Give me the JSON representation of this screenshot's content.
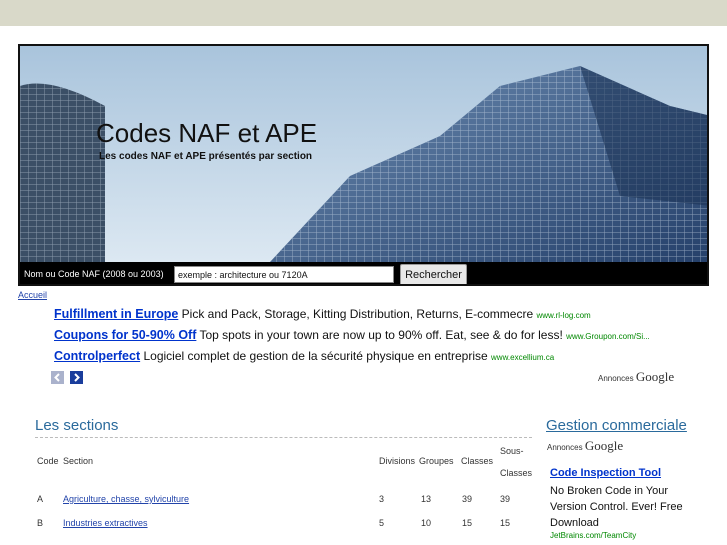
{
  "header": {
    "site_title": "Codes NAF et APE",
    "site_subtitle": "Les codes NAF et APE présentés par section"
  },
  "search": {
    "label": "Nom ou Code NAF (2008 ou 2003)",
    "value": "exemple : architecture ou 7120A",
    "button": "Rechercher"
  },
  "breadcrumb": "Accueil",
  "ads": [
    {
      "title": "Fulfillment in Europe",
      "text": "Pick and Pack, Storage, Kitting Distribution, Returns, E-commecre",
      "url": "www.rl-log.com"
    },
    {
      "title": "Coupons for 50-90% Off",
      "text": "Top spots in your town are now up to 90% off. Eat, see & do for less!",
      "url": "www.Groupon.com/Si..."
    },
    {
      "title": "Controlperfect",
      "text": "Logiciel complet de gestion de la sécurité physique en entreprise",
      "url": "www.excellium.ca"
    }
  ],
  "ads_label": {
    "prefix": "Annonces",
    "brand": "Google"
  },
  "sections": {
    "title": "Les sections",
    "columns": {
      "code": "Code",
      "section": "Section",
      "divisions": "Divisions",
      "groupes": "Groupes",
      "classes": "Classes",
      "sous_line1": "Sous-",
      "sous_line2": "Classes"
    },
    "rows": [
      {
        "code": "A",
        "section": "Agriculture, chasse, sylviculture",
        "divisions": "3",
        "groupes": "13",
        "classes": "39",
        "sous_classes": "39"
      },
      {
        "code": "B",
        "section": "Industries extractives",
        "divisions": "5",
        "groupes": "10",
        "classes": "15",
        "sous_classes": "15"
      }
    ]
  },
  "sidebar": {
    "title": "Gestion commerciale",
    "ads_prefix": "Annonces",
    "ads_brand": "Google",
    "ad": {
      "title": "Code Inspection Tool",
      "text": "No Broken Code in Your Version Control. Ever! Free Download",
      "url": "JetBrains.com/TeamCity"
    }
  },
  "colors": {
    "accent": "#2a6a9c",
    "link": "#0033cc",
    "ad_url": "#008800",
    "topbar": "#d9d9c9"
  },
  "icons": [
    "chevron-left-icon",
    "chevron-right-icon"
  ]
}
